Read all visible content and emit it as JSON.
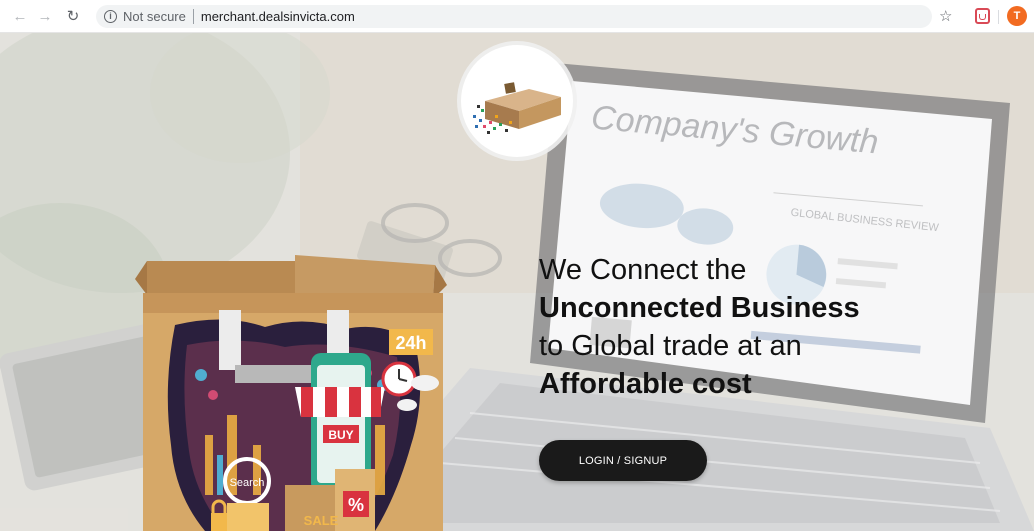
{
  "browser": {
    "security_label": "Not secure",
    "url": "merchant.dealsinvicta.com",
    "profile_initial": "T",
    "icons": [
      "back-arrow-icon",
      "forward-arrow-icon",
      "reload-icon",
      "info-icon",
      "star-icon",
      "extension-icon",
      "avatar"
    ]
  },
  "hero": {
    "line1": "We Connect the",
    "line2": "Unconnected Business",
    "line3": "to Global trade at an",
    "line4": "Affordable cost"
  },
  "cta": {
    "label": "LOGIN / SIGNUP"
  },
  "background": {
    "screen_heading": "Company's Growth",
    "screen_subheading": "GLOBAL BUSINESS REVIEW"
  },
  "illustration": {
    "badge": "24h",
    "buy_sign": "BUY",
    "search_label": "Search",
    "sale_label": "SALE",
    "percent_label": "%"
  },
  "colors": {
    "accent_orange": "#f26b21",
    "button_dark": "#1a1a1a",
    "bag_brown": "#c89a5e"
  }
}
